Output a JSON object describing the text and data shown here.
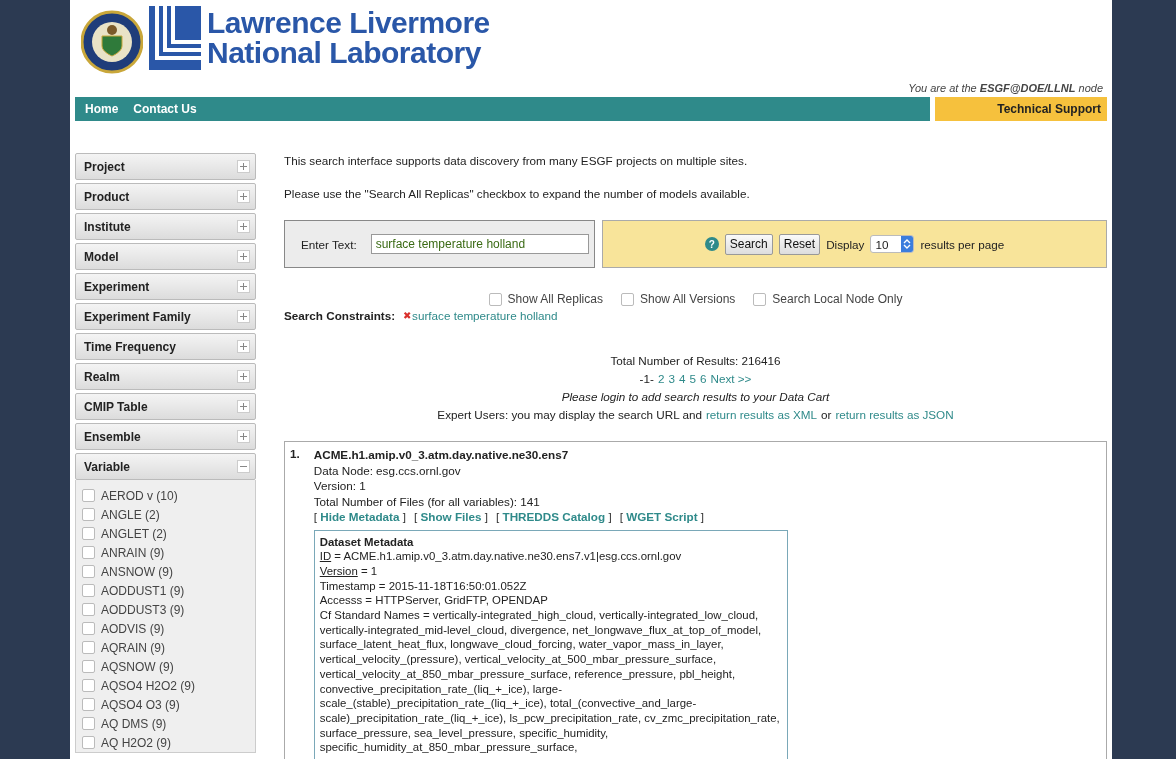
{
  "header": {
    "title_lines": [
      "Lawrence Livermore",
      "National Laboratory"
    ],
    "node_note": "You are at the **ESGF@DOE/LLNL** node"
  },
  "nav": {
    "links": [
      "Home",
      "Contact Us"
    ],
    "support": "Technical Support"
  },
  "sidebar": {
    "facets": [
      {
        "label": "Project",
        "expanded": false
      },
      {
        "label": "Product",
        "expanded": false
      },
      {
        "label": "Institute",
        "expanded": false
      },
      {
        "label": "Model",
        "expanded": false
      },
      {
        "label": "Experiment",
        "expanded": false
      },
      {
        "label": "Experiment Family",
        "expanded": false
      },
      {
        "label": "Time Frequency",
        "expanded": false
      },
      {
        "label": "Realm",
        "expanded": false
      },
      {
        "label": "CMIP Table",
        "expanded": false
      },
      {
        "label": "Ensemble",
        "expanded": false
      },
      {
        "label": "Variable",
        "expanded": true,
        "options": [
          {
            "label": "AEROD v (10)",
            "checked": false
          },
          {
            "label": "ANGLE (2)",
            "checked": false
          },
          {
            "label": "ANGLET (2)",
            "checked": false
          },
          {
            "label": "ANRAIN (9)",
            "checked": false
          },
          {
            "label": "ANSNOW (9)",
            "checked": false
          },
          {
            "label": "AODDUST1 (9)",
            "checked": false
          },
          {
            "label": "AODDUST3 (9)",
            "checked": false
          },
          {
            "label": "AODVIS (9)",
            "checked": false
          },
          {
            "label": "AQRAIN (9)",
            "checked": false
          },
          {
            "label": "AQSNOW (9)",
            "checked": false
          },
          {
            "label": "AQSO4 H2O2 (9)",
            "checked": false
          },
          {
            "label": "AQSO4 O3 (9)",
            "checked": false
          },
          {
            "label": "AQ DMS (9)",
            "checked": false
          },
          {
            "label": "AQ H2O2 (9)",
            "checked": false
          }
        ]
      }
    ]
  },
  "intro": [
    "This search interface supports data discovery from many ESGF projects on multiple sites.",
    "Please use the \"Search All Replicas\" checkbox to expand the number of models available."
  ],
  "search": {
    "label": "Enter Text:",
    "value": "surface temperature holland",
    "help": "?",
    "buttons": [
      "Search",
      "Reset"
    ],
    "display_label": "Display",
    "per_page": "10",
    "per_page_suffix": "results per page"
  },
  "options": [
    {
      "label": "Show All Replicas",
      "checked": false
    },
    {
      "label": "Show All Versions",
      "checked": false
    },
    {
      "label": "Search Local Node Only",
      "checked": false
    }
  ],
  "constraints": {
    "label": "Search Constraints:",
    "remove": "✖",
    "items": [
      "surface temperature holland"
    ]
  },
  "summary": {
    "total": "Total Number of Results: 216416",
    "pages": [
      {
        "label": "-1-",
        "selected": true
      },
      {
        "label": "2",
        "selected": false
      },
      {
        "label": "3",
        "selected": false
      },
      {
        "label": "4",
        "selected": false
      },
      {
        "label": "5",
        "selected": false
      },
      {
        "label": "6",
        "selected": false
      },
      {
        "label": "Next >>",
        "selected": false
      }
    ],
    "login_note": "Please login to add search results to your Data Cart",
    "expert_text": "Expert Users: you may display the search URL and",
    "xml_link": "return results as XML",
    "or": "or",
    "json_link": "return results as JSON"
  },
  "results": [
    {
      "number": "1.",
      "title": "ACME.h1.amip.v0_3.atm.day.native.ne30.ens7",
      "lines": [
        "Data Node: esg.ccs.ornl.gov",
        "Version: 1",
        "Total Number of Files (for all variables): 141"
      ],
      "links": [
        "Hide Metadata",
        "Show Files",
        "THREDDS Catalog",
        "WGET Script"
      ],
      "link_open": "[",
      "link_close": "]",
      "metadata": {
        "title": "Dataset Metadata",
        "fields": [
          {
            "key": "ID",
            "underlined": true,
            "value": " = ACME.h1.amip.v0_3.atm.day.native.ne30.ens7.v1|esg.ccs.ornl.gov"
          },
          {
            "key": "Version",
            "underlined": true,
            "value": " = 1"
          },
          {
            "key": "Timestamp",
            "underlined": false,
            "value": " = 2015-11-18T16:50:01.052Z"
          },
          {
            "key": "Accesss",
            "underlined": false,
            "value": " = HTTPServer, GridFTP, OPENDAP"
          },
          {
            "key": "Cf Standard Names",
            "underlined": false,
            "value": " = vertically-integrated_high_cloud, vertically-integrated_low_cloud, vertically-integrated_mid-level_cloud, divergence, net_longwave_flux_at_top_of_model, surface_latent_heat_flux, longwave_cloud_forcing, water_vapor_mass_in_layer, vertical_velocity_(pressure), vertical_velocity_at_500_mbar_pressure_surface, vertical_velocity_at_850_mbar_pressure_surface, reference_pressure, pbl_height, convective_precipitation_rate_(liq_+_ice), large-scale_(stable)_precipitation_rate_(liq_+_ice), total_(convective_and_large-scale)_precipitation_rate_(liq_+_ice), ls_pcw_precipitation_rate, cv_zmc_precipitation_rate, surface_pressure, sea_level_pressure, specific_humidity, specific_humidity_at_850_mbar_pressure_surface,"
          }
        ]
      }
    }
  ]
}
